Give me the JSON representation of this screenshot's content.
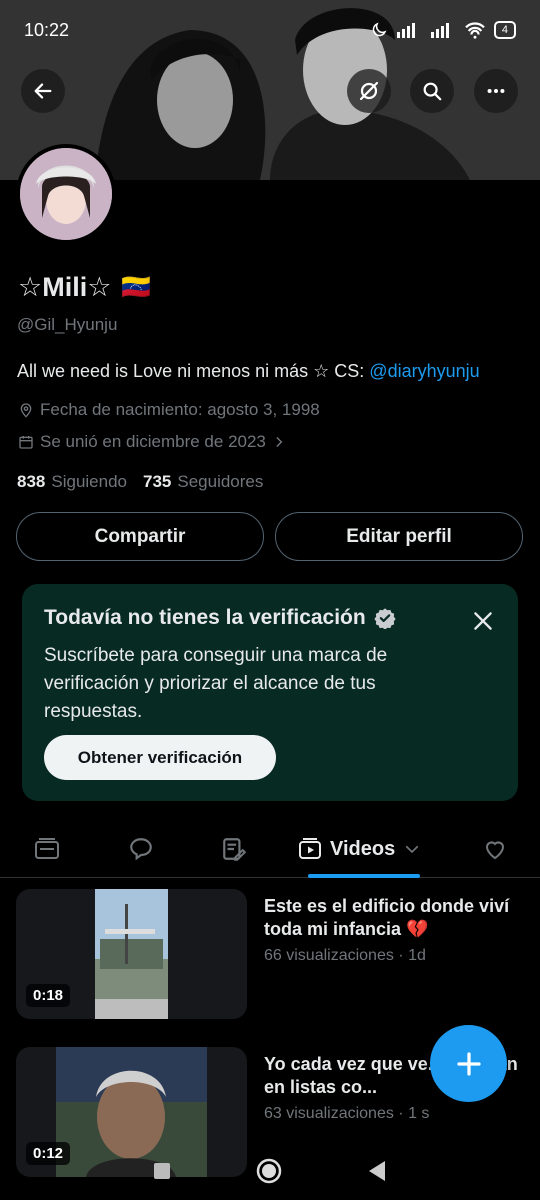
{
  "status_bar": {
    "time": "10:22",
    "battery": "4"
  },
  "profile": {
    "display_name": "☆Mili☆",
    "flag": "🇻🇪",
    "handle": "@Gil_Hyunju",
    "bio_text": "All we need is Love ni menos ni más ☆ CS: ",
    "bio_mention": "@diaryhyunju",
    "birth": "Fecha de nacimiento: agosto 3, 1998",
    "joined": "Se unió en diciembre de 2023",
    "following_count": "838",
    "following_label": "Siguiendo",
    "followers_count": "735",
    "followers_label": "Seguidores"
  },
  "actions": {
    "share_label": "Compartir",
    "edit_label": "Editar perfil"
  },
  "verify_card": {
    "title": "Todavía no tienes la verificación",
    "text": "Suscríbete para conseguir una marca de verificación y priorizar el alcance de tus respuestas.",
    "cta": "Obtener verificación"
  },
  "tabs": {
    "active_label": "Videos"
  },
  "videos": [
    {
      "title": "Este es el edificio donde viví toda mi infancia 💔",
      "meta": "66 visualizaciones · 1d",
      "duration": "0:18"
    },
    {
      "title": "Yo cada vez que ve... agregan en listas co...",
      "meta": "63 visualizaciones · 1 s",
      "duration": "0:12"
    }
  ],
  "colors": {
    "accent": "#1d9bf0",
    "card_bg": "#072a22",
    "muted": "#71767b"
  }
}
